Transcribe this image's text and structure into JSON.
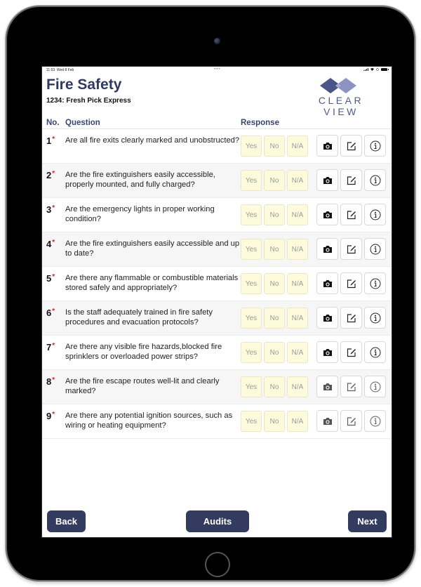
{
  "status_bar": {
    "time": "11:53",
    "date": "Wed 8 Feb",
    "dots": "•••"
  },
  "header": {
    "title": "Fire Safety",
    "subtitle": "1234: Fresh Pick Express",
    "logo_text": "CLEAR VIEW"
  },
  "columns": {
    "no": "No.",
    "question": "Question",
    "response": "Response"
  },
  "response_options": [
    "Yes",
    "No",
    "N/A"
  ],
  "required_marker": "*",
  "questions": [
    {
      "no": "1",
      "text": "Are all fire exits clearly marked and unobstructed?"
    },
    {
      "no": "2",
      "text": "Are the fire extinguishers easily accessible, properly mounted, and fully charged?"
    },
    {
      "no": "3",
      "text": "Are the emergency lights in proper working condition?"
    },
    {
      "no": "4",
      "text": "Are the fire extinguishers easily accessible and up to date?"
    },
    {
      "no": "5",
      "text": "Are there any flammable or combustible materials stored safely and appropriately?"
    },
    {
      "no": "6",
      "text": "Is the staff adequately trained in fire safety procedures and evacuation protocols?"
    },
    {
      "no": "7",
      "text": "Are there any visible fire hazards,blocked fire sprinklers or overloaded power strips?"
    },
    {
      "no": "8",
      "text": "Are the fire escape routes well-lit and clearly marked?"
    },
    {
      "no": "9",
      "text": "Are there any potential ignition sources, such as wiring or heating equipment?"
    }
  ],
  "row_tools": [
    "camera-icon",
    "edit-icon",
    "info-icon"
  ],
  "footer": {
    "back": "Back",
    "audits": "Audits",
    "next": "Next"
  },
  "colors": {
    "brand": "#333b5f",
    "title": "#2f3a63",
    "required": "#e02020",
    "response_bg": "#fdfbdc"
  }
}
